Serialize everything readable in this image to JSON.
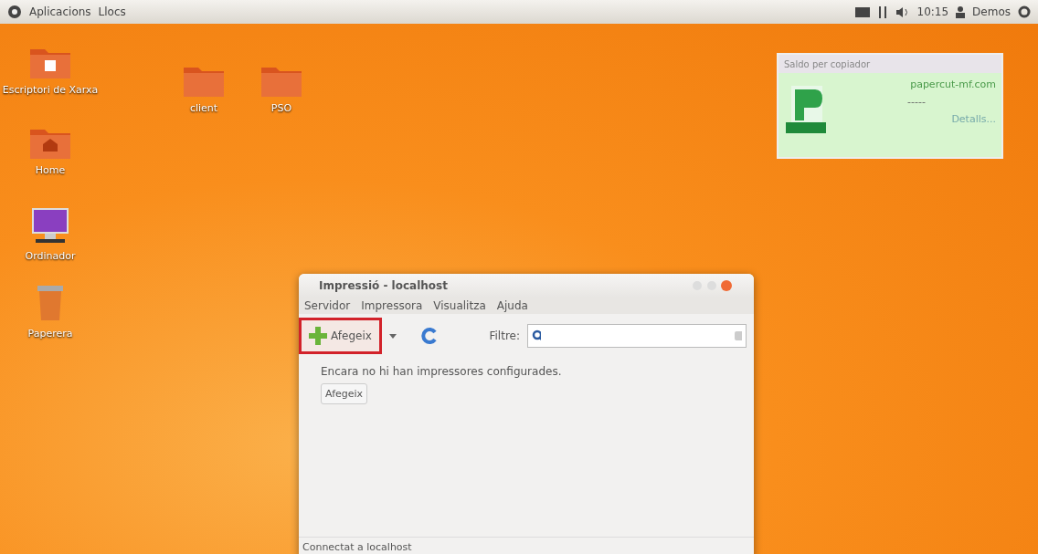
{
  "top_panel": {
    "menus": [
      "Aplicacions",
      "Llocs"
    ],
    "clock": "10:15",
    "user": "Demos"
  },
  "desktop_icons": [
    {
      "kind": "network",
      "label": "Escriptori de Xarxa"
    },
    {
      "kind": "folder",
      "label": "client"
    },
    {
      "kind": "folder",
      "label": "PSO"
    },
    {
      "kind": "home",
      "label": "Home"
    },
    {
      "kind": "computer",
      "label": "Ordinador"
    },
    {
      "kind": "trash",
      "label": "Paperera"
    }
  ],
  "balance_popup": {
    "title": "Saldo per copiador",
    "server": "papercut-mf.com",
    "balance": "-----",
    "link": "Detalls..."
  },
  "window": {
    "title": "Impressió - localhost",
    "menu": [
      "Servidor",
      "Impressora",
      "Visualitza",
      "Ajuda"
    ],
    "toolbar": {
      "add_button": "Afegeix",
      "highlighted": true,
      "filter_label": "Filtre:"
    },
    "message": "Encara no hi han impressores configurades.",
    "add_button": "Afegeix",
    "status": "Connectat a localhost"
  }
}
